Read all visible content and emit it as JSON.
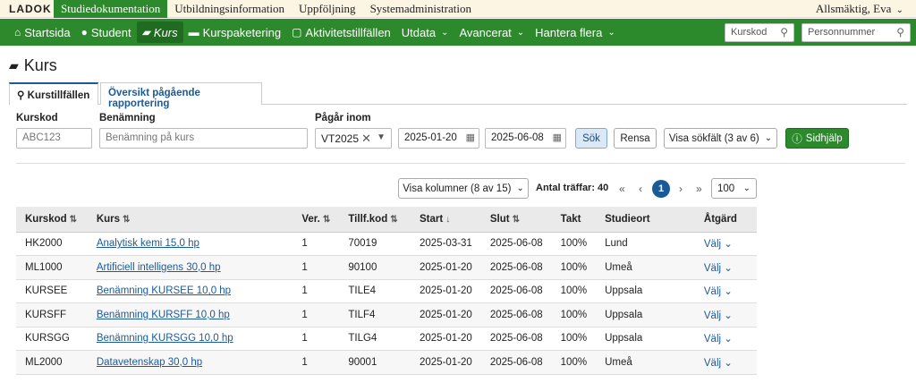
{
  "topbar": {
    "logo": "LADOK",
    "tabs": [
      "Studiedokumentation",
      "Utbildningsinformation",
      "Uppföljning",
      "Systemadministration"
    ],
    "user": "Allsmäktig, Eva"
  },
  "nav": {
    "items": [
      "Startsida",
      "Student",
      "Kurs",
      "Kurspaketering",
      "Aktivitetstillfällen",
      "Utdata",
      "Avancerat",
      "Hantera flera"
    ],
    "search_kurskod": "Kurskod",
    "search_pnr": "Personnummer"
  },
  "page": {
    "title": "Kurs",
    "tabs": [
      "Kurstillfällen",
      "Översikt pågående rapportering"
    ]
  },
  "filter": {
    "kurskod_label": "Kurskod",
    "kurskod_placeholder": "ABC123",
    "benamning_label": "Benämning",
    "benamning_placeholder": "Benämning på kurs",
    "pagar_label": "Pågår inom",
    "period": "VT2025",
    "date_from": "2025-01-20",
    "date_to": "2025-06-08",
    "search_btn": "Sök",
    "clear_btn": "Rensa",
    "show_fields_btn": "Visa sökfält (3 av 6)",
    "help_btn": "Sidhjälp"
  },
  "results": {
    "columns_btn": "Visa kolumner (8 av 15)",
    "hits_label": "Antal träffar: 40",
    "current_page": "1",
    "page_size": "100",
    "headers": [
      "Kurskod",
      "Kurs",
      "Ver.",
      "Tillf.kod",
      "Start",
      "Slut",
      "Takt",
      "Studieort",
      "Åtgärd"
    ],
    "rows": [
      {
        "kod": "HK2000",
        "kurs": "Analytisk kemi 15,0 hp",
        "ver": "1",
        "tillf": "70019",
        "start": "2025-03-31",
        "slut": "2025-06-08",
        "takt": "100%",
        "ort": "Lund",
        "atgard": "Välj"
      },
      {
        "kod": "ML1000",
        "kurs": "Artificiell intelligens 30,0 hp",
        "ver": "1",
        "tillf": "90100",
        "start": "2025-01-20",
        "slut": "2025-06-08",
        "takt": "100%",
        "ort": "Umeå",
        "atgard": "Välj"
      },
      {
        "kod": "KURSEE",
        "kurs": "Benämning KURSEE 10,0 hp",
        "ver": "1",
        "tillf": "TILE4",
        "start": "2025-01-20",
        "slut": "2025-06-08",
        "takt": "100%",
        "ort": "Uppsala",
        "atgard": "Välj"
      },
      {
        "kod": "KURSFF",
        "kurs": "Benämning KURSFF 10,0 hp",
        "ver": "1",
        "tillf": "TILF4",
        "start": "2025-01-20",
        "slut": "2025-06-08",
        "takt": "100%",
        "ort": "Uppsala",
        "atgard": "Välj"
      },
      {
        "kod": "KURSGG",
        "kurs": "Benämning KURSGG 10,0 hp",
        "ver": "1",
        "tillf": "TILG4",
        "start": "2025-01-20",
        "slut": "2025-06-08",
        "takt": "100%",
        "ort": "Uppsala",
        "atgard": "Välj"
      },
      {
        "kod": "ML2000",
        "kurs": "Datavetenskap 30,0 hp",
        "ver": "1",
        "tillf": "90001",
        "start": "2025-01-20",
        "slut": "2025-06-08",
        "takt": "100%",
        "ort": "Umeå",
        "atgard": "Välj"
      }
    ]
  }
}
